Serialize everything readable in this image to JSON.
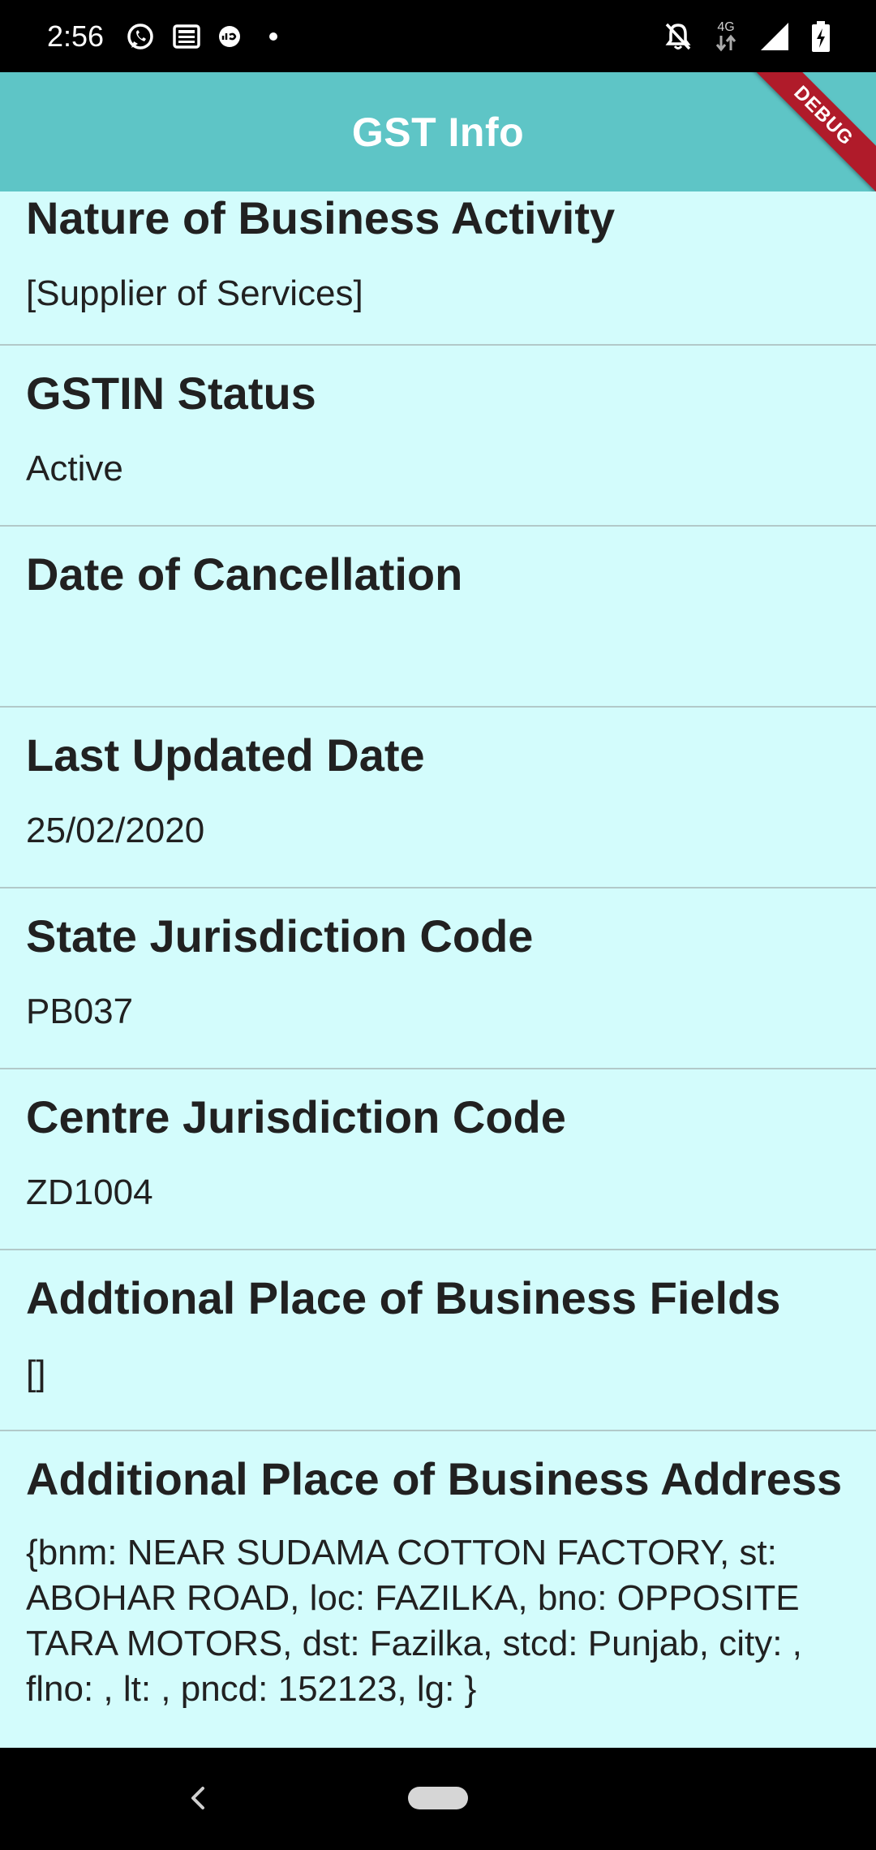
{
  "status_bar": {
    "time": "2:56",
    "network_label": "4G",
    "left_icons": [
      "whatsapp-icon",
      "news-icon",
      "jio-icon",
      "dot-icon"
    ],
    "right_icons": [
      "notifications-off-icon",
      "network-4g-icon",
      "signal-icon",
      "battery-charging-icon"
    ]
  },
  "app_bar": {
    "title": "GST Info",
    "debug_banner": "DEBUG",
    "color": "#5ec5c6"
  },
  "colors": {
    "background": "#d3fcfc",
    "debug_ribbon": "#b01b2a",
    "divider": "#b2c9c9"
  },
  "items": [
    {
      "label": "Nature of Business Activity",
      "value": "[Supplier of Services]"
    },
    {
      "label": "GSTIN Status",
      "value": "Active"
    },
    {
      "label": "Date of Cancellation",
      "value": ""
    },
    {
      "label": "Last Updated Date",
      "value": "25/02/2020"
    },
    {
      "label": "State Jurisdiction Code",
      "value": "PB037"
    },
    {
      "label": "Centre Jurisdiction Code",
      "value": "ZD1004"
    },
    {
      "label": "Addtional Place of Business Fields",
      "value": "[]"
    },
    {
      "label": "Additional Place of Business Address",
      "value": "{bnm: NEAR SUDAMA COTTON FACTORY, st: ABOHAR ROAD, loc: FAZILKA, bno: OPPOSITE TARA MOTORS, dst: Fazilka, stcd: Punjab, city: , flno: , lt: , pncd: 152123, lg: }"
    }
  ],
  "nav_bar": {
    "icons": [
      "back-icon",
      "home-pill-icon"
    ]
  }
}
